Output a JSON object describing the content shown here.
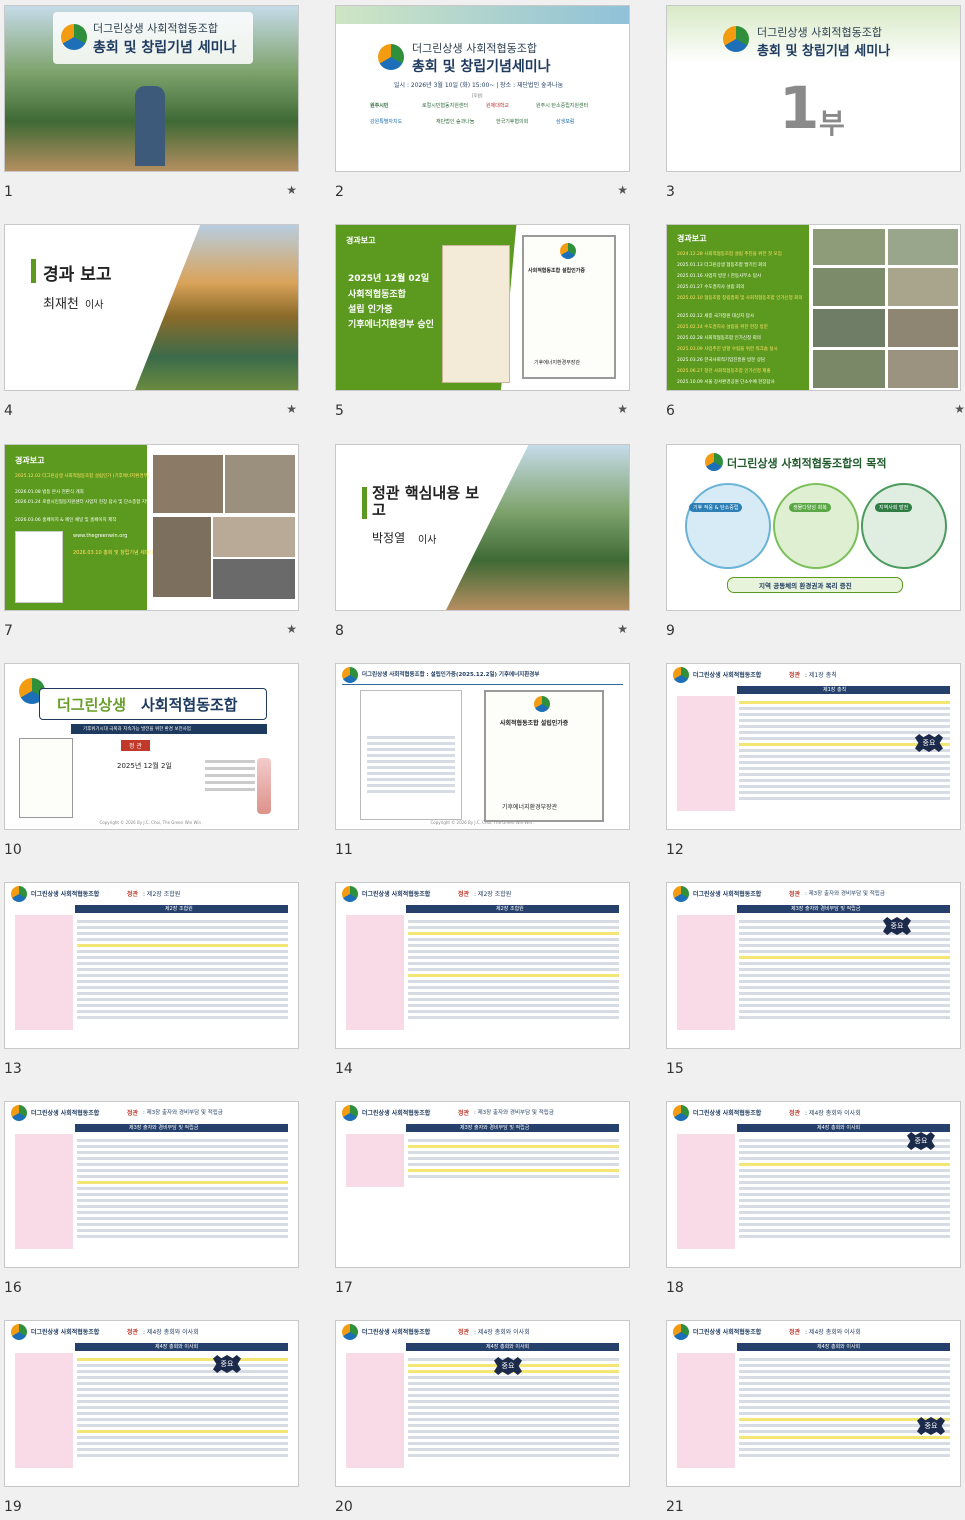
{
  "slides": [
    {
      "num": "1",
      "starred": true,
      "title_line1": "더그린상생 사회적협동조합",
      "title_line2": "총회 및 창립기념 세미나"
    },
    {
      "num": "2",
      "starred": true,
      "title_line1": "더그린상생 사회적협동조합",
      "title_line2": "총회 및 창립기념세미나",
      "info": "일시 : 2026년 3월 10일 (화) 15:00~    |    장소 : 재단법인 숲과나눔",
      "sponsor_label": "[후원]",
      "sponsors": [
        "원주시민",
        "로컬시민협동지원센터",
        "원제대학교",
        "원주시 탄소중립지원센터",
        "강원특별자치도",
        "재단법인 숲과나눔",
        "한국기후협의회",
        "삼생포럼"
      ]
    },
    {
      "num": "3",
      "starred": false,
      "title_line1": "더그린상생 사회적협동조합",
      "title_line2": "총회 및 창립기념 세미나",
      "part_big": "1",
      "part_suffix": "부"
    },
    {
      "num": "4",
      "starred": true,
      "heading": "경과 보고",
      "presenter": "최재천",
      "role": "이사"
    },
    {
      "num": "5",
      "starred": true,
      "tag": "경과보고",
      "date": "2025년 12월 02일",
      "lines": [
        "사회적협동조합",
        "설립 인가증",
        "기후에너지환경부 승인"
      ],
      "doc_title": "사회적협동조합 설립인가증",
      "doc_footer": "기후에너지환경부장관"
    },
    {
      "num": "6",
      "starred": true,
      "tag": "경과보고",
      "events": [
        "2024.12.28 사회적협동조합 설립 추진을 위한 첫 모임",
        "2025.01.13 더그린상생 협동조합 발기인 회의",
        "2025.01.16 사업지 방문 / 한동사무소 답사",
        "2025.01.27 수도권지사 설립 회의",
        "2025.02.10 협동조합 창립총회 및 사회적협동조합 인가신청 회의",
        "2025.02.12 세종 국가정원 대상지 답사",
        "2025.02.14 수도권지사 설립을 위한 현장 방문",
        "2025.02.28 사회적협동조합 인가신청 회의",
        "2025.03.09 사업추진 방향 수립을 위한 워크숍 실시",
        "2025.03.26 한국사회적기업진흥원 방문 상담",
        "2025.06.27 정관 사회적협동조합 인가신청 제출",
        "2025.10.09 서울 강서환경공원 단소수예 현장답사"
      ]
    },
    {
      "num": "7",
      "starred": true,
      "tag": "경과보고",
      "events": [
        "2025.12.02 더그린상생 사회적협동조합 설립인가 (기후에너지환경부)",
        "2026.01.08 법등 본사 현판식 개최",
        "2026.01.24 로컬시민협동지원센터 사업지 현장 답사 및 단소종합 지역 협의회 참여",
        "2026.03.06 홈페이지 & 페인 채널 및 홈페이지 제작"
      ],
      "website": "www.thegreenwin.org",
      "closing": "2026.03.10 총회 및 창립기념 세미나"
    },
    {
      "num": "8",
      "starred": true,
      "heading": "정관 핵심내용 보고",
      "presenter": "박정열",
      "role": "이사"
    },
    {
      "num": "9",
      "starred": false,
      "title": "더그린상생 사회적협동조합의 목적",
      "pillars": [
        "기후 적응 & 탄소중립",
        "생물다양성 회복",
        "지역사회 발전"
      ],
      "banner": "지역 공동체의 환경권과 복리 증진"
    },
    {
      "num": "10",
      "starred": false,
      "title_a": "더그린상생",
      "title_b": "사회적협동조합",
      "subtitle": "기후위기시대 극복과 지속가능 발전을 위한 환경 보전사업",
      "badge": "정 관",
      "date": "2025년 12월 2일",
      "footer": "Copyright © 2026 By J.C. Choi, The Green Win Win ."
    },
    {
      "num": "11",
      "starred": false,
      "header": "더그린상생 사회적협동조합 : 설립인가증(2025.12.2일) 기후에너지환경부",
      "doc_title": "사회적협동조합 설립인가증",
      "doc_footer": "기후에너지환경부장관",
      "footer": "Copyright © 2026 By J.C. Choi, The Green Win Win ."
    },
    {
      "num": "12",
      "starred": false,
      "header_a": "더그린상생 사회적협동조합",
      "header_b": "정관",
      "header_c": ": 제1장 총칙",
      "table_title": "제1장 총칙",
      "stamp": "중요"
    },
    {
      "num": "13",
      "starred": false,
      "header_a": "더그린상생 사회적협동조합",
      "header_b": "정관",
      "header_c": ": 제2장 조합원",
      "table_title": "제2장 조합원"
    },
    {
      "num": "14",
      "starred": false,
      "header_a": "더그린상생 사회적협동조합",
      "header_b": "정관",
      "header_c": ": 제2장 조합원",
      "table_title": "제2장 조합원"
    },
    {
      "num": "15",
      "starred": false,
      "header_a": "더그린상생 사회적협동조합",
      "header_b": "정관",
      "header_c": ": 제3장 출자와 경비부담 및 적립금",
      "table_title": "제3장 출자와 경비부담 및 적립금",
      "stamp": "중요"
    },
    {
      "num": "16",
      "starred": false,
      "header_a": "더그린상생 사회적협동조합",
      "header_b": "정관",
      "header_c": ": 제3장 출자와 경비부담 및 적립금",
      "table_title": "제3장 출자와 경비부담 및 적립금"
    },
    {
      "num": "17",
      "starred": false,
      "header_a": "더그린상생 사회적협동조합",
      "header_b": "정관",
      "header_c": ": 제3장 출자와 경비부담 및 적립금",
      "table_title": "제3장 출자와 경비부담 및 적립금"
    },
    {
      "num": "18",
      "starred": false,
      "header_a": "더그린상생 사회적협동조합",
      "header_b": "정관",
      "header_c": ": 제4장 총회와 이사회",
      "table_title": "제4장 총회와 이사회",
      "stamp": "중요"
    },
    {
      "num": "19",
      "starred": false,
      "header_a": "더그린상생 사회적협동조합",
      "header_b": "정관",
      "header_c": ": 제4장 총회와 이사회",
      "table_title": "제4장 총회와 이사회",
      "stamp": "중요"
    },
    {
      "num": "20",
      "starred": false,
      "header_a": "더그린상생 사회적협동조합",
      "header_b": "정관",
      "header_c": ": 제4장 총회와 이사회",
      "table_title": "제4장 총회와 이사회",
      "stamp": "중요"
    },
    {
      "num": "21",
      "starred": false,
      "header_a": "더그린상생 사회적협동조합",
      "header_b": "정관",
      "header_c": ": 제4장 총회와 이사회",
      "table_title": "제4장 총회와 이사회",
      "stamp": "중요"
    }
  ],
  "star_glyph": "★"
}
